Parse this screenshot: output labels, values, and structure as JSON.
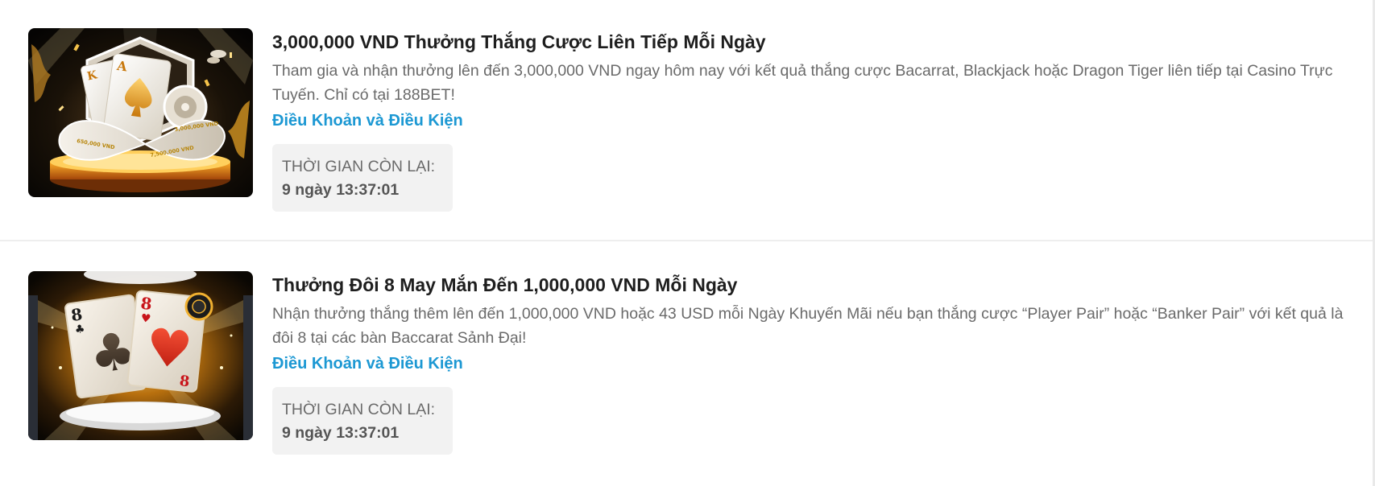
{
  "promotions": [
    {
      "title": "3,000,000 VND Thưởng Thắng Cược Liên Tiếp Mỗi Ngày",
      "description": "Tham gia và nhận thưởng lên đến 3,000,000 VND ngay hôm nay với kết quả thắng cược Bacarrat, Blackjack hoặc Dragon Tiger liên tiếp tại Casino Trực Tuyến. Chỉ có tại 188BET!",
      "terms_link": "Điều Khoản và Điều Kiện",
      "timer_label": "THỜI GIAN CÒN LẠI:",
      "timer_value": "9 ngày 13:37:01",
      "banner": {
        "labels": [
          "3,000,000 VND",
          "650,000 VND",
          "7,500,000 VND"
        ],
        "card_ranks": [
          "K",
          "A"
        ]
      }
    },
    {
      "title": "Thưởng Đôi 8 May Mắn Đến 1,000,000 VND Mỗi Ngày",
      "description": "Nhận thưởng thắng thêm lên đến 1,000,000 VND hoặc 43 USD mỗi Ngày Khuyến Mãi nếu bạn thắng cược “Player Pair” hoặc “Banker Pair” với kết quả là đôi 8 tại các bàn Baccarat Sảnh Đại!",
      "terms_link": "Điều Khoản và Điều Kiện",
      "timer_label": "THỜI GIAN CÒN LẠI:",
      "timer_value": "9 ngày 13:37:01",
      "banner": {
        "card_ranks": [
          "8",
          "8"
        ]
      }
    }
  ],
  "colors": {
    "title": "#1e1e1e",
    "body_text": "#6a6a6a",
    "link": "#1c98d3",
    "timer_bg": "#f2f2f2",
    "divider": "#eeeeee"
  }
}
